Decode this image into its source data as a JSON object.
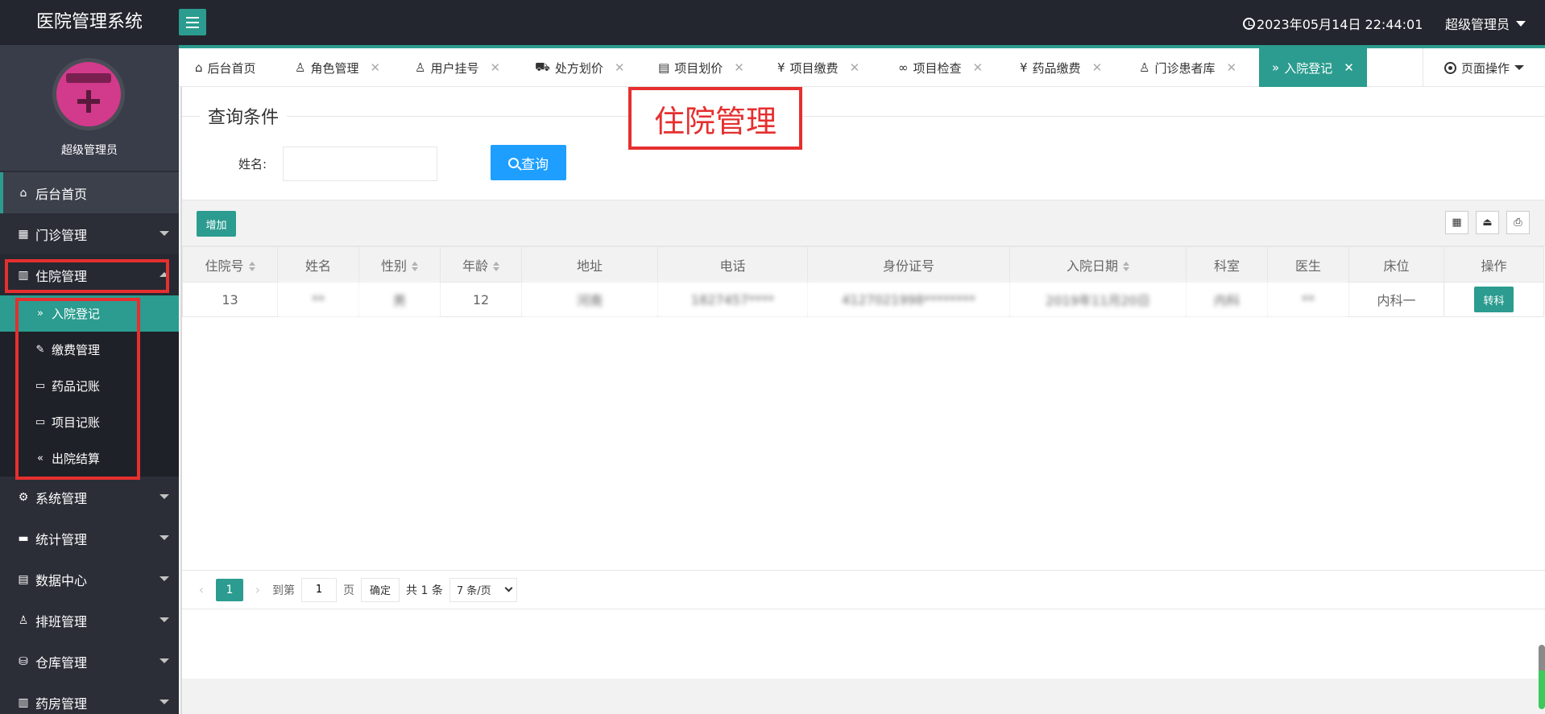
{
  "app": {
    "title": "医院管理系统"
  },
  "header": {
    "datetime": "2023年05月14日 22:44:01",
    "user": "超级管理员"
  },
  "sidebar": {
    "admin_name": "超级管理员",
    "items": [
      {
        "label": "后台首页",
        "icon": "home-icon"
      },
      {
        "label": "门诊管理",
        "icon": "grid-icon"
      },
      {
        "label": "住院管理",
        "icon": "building-icon"
      },
      {
        "label": "系统管理",
        "icon": "gear-icon"
      },
      {
        "label": "统计管理",
        "icon": "chart-icon"
      },
      {
        "label": "数据中心",
        "icon": "document-icon"
      },
      {
        "label": "排班管理",
        "icon": "user-icon"
      },
      {
        "label": "仓库管理",
        "icon": "warehouse-icon"
      },
      {
        "label": "药房管理",
        "icon": "pharmacy-icon"
      }
    ],
    "inpatient_sub": [
      {
        "label": "入院登记",
        "icon": "double-chevron-icon"
      },
      {
        "label": "缴费管理",
        "icon": "edit-icon"
      },
      {
        "label": "药品记账",
        "icon": "book-icon"
      },
      {
        "label": "项目记账",
        "icon": "book-icon"
      },
      {
        "label": "出院结算",
        "icon": "double-chevron-left-icon"
      }
    ]
  },
  "tabs": [
    {
      "label": "后台首页"
    },
    {
      "label": "角色管理"
    },
    {
      "label": "用户挂号"
    },
    {
      "label": "处方划价"
    },
    {
      "label": "项目划价"
    },
    {
      "label": "项目缴费"
    },
    {
      "label": "项目检查"
    },
    {
      "label": "药品缴费"
    },
    {
      "label": "门诊患者库"
    },
    {
      "label": "入院登记"
    }
  ],
  "page_ops": "页面操作",
  "query": {
    "legend": "查询条件",
    "name_label": "姓名:",
    "name_value": "",
    "search_label": "查询"
  },
  "annotation": "住院管理",
  "toolbar": {
    "add_label": "增加"
  },
  "table": {
    "columns": [
      "住院号",
      "姓名",
      "性别",
      "年龄",
      "地址",
      "电话",
      "身份证号",
      "入院日期",
      "科室",
      "医生",
      "床位",
      "操作"
    ],
    "rows": [
      {
        "id": "13",
        "name": "**",
        "gender": "男",
        "age": "12",
        "address": "河南",
        "phone": "1827457****",
        "idcard": "4127021998********",
        "date": "2019年11月20日",
        "dept": "内科",
        "doctor": "**",
        "bed": "内科一",
        "action": "转科"
      }
    ]
  },
  "pager": {
    "current": "1",
    "goto_label": "到第",
    "goto_value": "1",
    "page_unit": "页",
    "ok": "确定",
    "total": "共 1 条",
    "page_size": "7 条/页"
  },
  "colors": {
    "accent": "#2b9c8f",
    "header": "#23262e",
    "sidebar": "#2b2e37",
    "highlight": "#e62f2f",
    "search": "#1e9fff"
  }
}
